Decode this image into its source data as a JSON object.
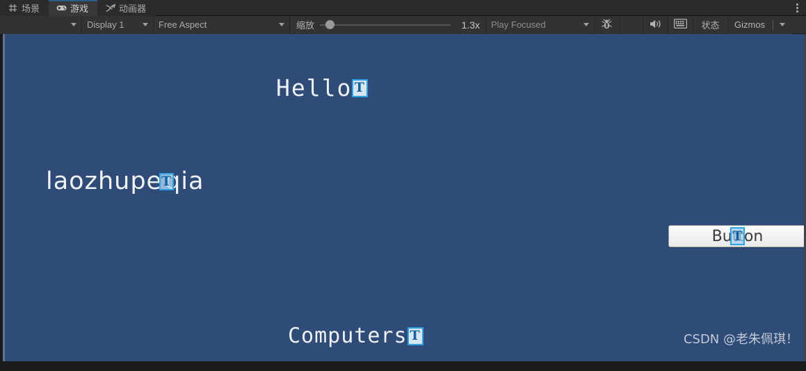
{
  "window": {
    "title": "Unity Game View",
    "tabs": [
      {
        "label": "场景",
        "icon": "grid-icon",
        "active": false
      },
      {
        "label": "游戏",
        "icon": "gamepad-icon",
        "active": true
      },
      {
        "label": "动画器",
        "icon": "branch-icon",
        "active": false
      }
    ],
    "tab_menu_icon": "kebab-menu-icon"
  },
  "toolbar": {
    "aspect_first_value": "",
    "display_label": "Display 1",
    "aspect_label": "Free Aspect",
    "zoom_label": "缩放",
    "zoom_value": "1.3x",
    "zoom_slider_percent": 4,
    "play_focus_label": "Play Focused",
    "debug_icon": "bug-icon",
    "mute_audio_icon": "speaker-icon",
    "stats_grid_icon": "stats-grid-icon",
    "stats_label": "状态",
    "gizmos_label": "Gizmos"
  },
  "game_view": {
    "background_color": "#2f4c78",
    "objects": [
      {
        "name": "hello-text",
        "text": "Hello",
        "badge": "T"
      },
      {
        "name": "laozhu-text",
        "text": "laozhupeiqia",
        "badge": "T"
      },
      {
        "name": "computers-text",
        "text": "Computers",
        "badge": "T"
      },
      {
        "name": "ui-button",
        "text": "Button",
        "badge": "T"
      }
    ],
    "hello_text": "Hello",
    "laozhu_text_before": "laozhupe",
    "laozhu_text_after": "qia",
    "computers_text": "Computers",
    "button_text": "Button",
    "badge_glyph": "T",
    "watermark": "CSDN @老朱佩琪！"
  },
  "colors": {
    "accent_blue": "#2aa3e8",
    "tab_active_border": "#2c5d87",
    "game_bg": "#2f4c78",
    "toolbar_bg": "#323232"
  }
}
